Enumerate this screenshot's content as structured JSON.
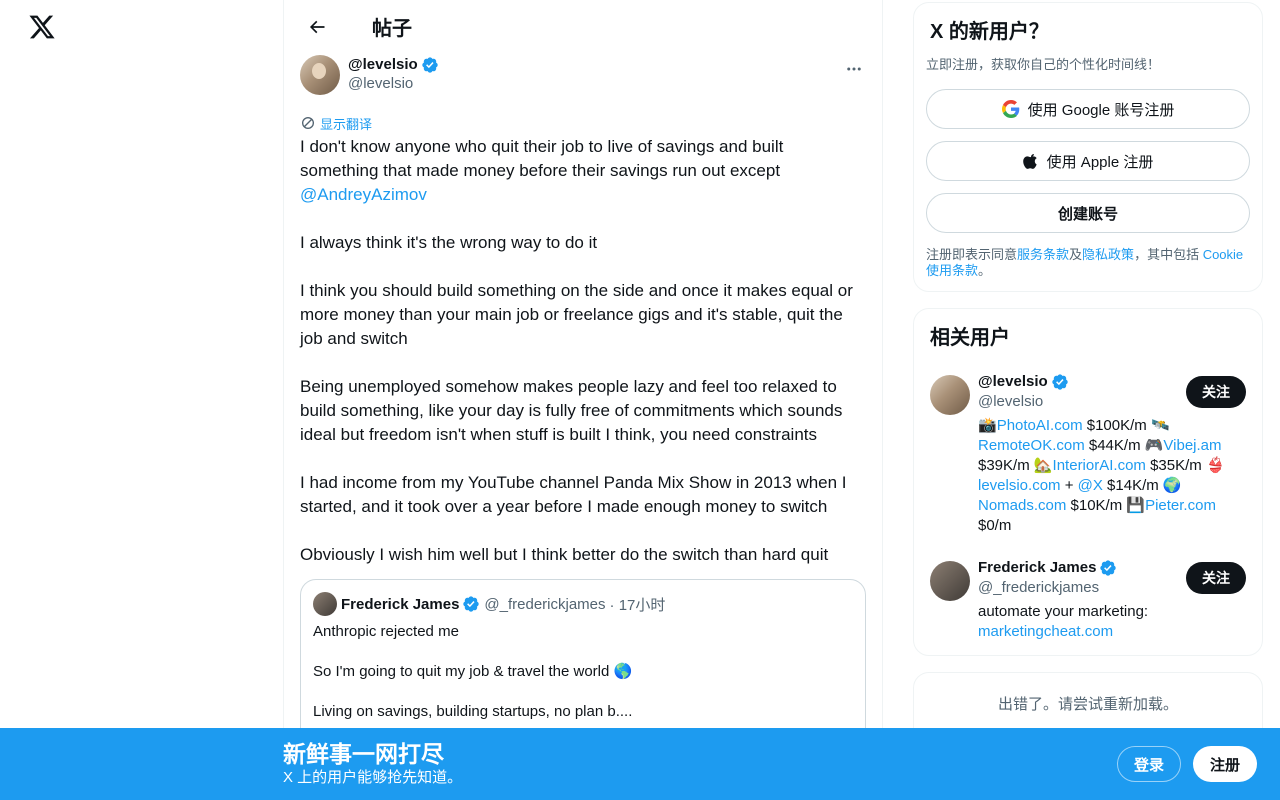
{
  "header": {
    "title": "帖子"
  },
  "post": {
    "author_name": "@levelsio",
    "author_handle": "@levelsio",
    "translate_label": "显示翻译",
    "text_before_mention": "I don't know anyone who quit their job to live of savings and built something that made money before their savings run out except ",
    "mention": "@AndreyAzimov",
    "text_after_mention": "\n\nI always think it's the wrong way to do it\n\nI think you should build something on the side and once it makes equal or more money than your main job or freelance gigs and it's stable, quit the job and switch\n\nBeing unemployed somehow makes people lazy and feel too relaxed to build something, like your day is fully free of commitments which sounds ideal but freedom isn't when stuff is built I think, you need constraints\n\nI had income from my YouTube channel Panda Mix Show in 2013 when I started, and it took over a year before I made enough money to switch\n\nObviously I wish him well but I think better do the switch than hard quit",
    "quote": {
      "name": "Frederick James",
      "handle": "@_frederickjames",
      "time": "· 17小时",
      "text": "Anthropic rejected me\n\nSo I'm going to quit my job & travel the world 🌎\n\nLiving on savings, building startups, no plan b...."
    }
  },
  "signup": {
    "title": "X 的新用户？",
    "subtitle": "立即注册，获取你自己的个性化时间线！",
    "google_label": "使用 Google 账号注册",
    "apple_label": "使用 Apple 注册",
    "create_label": "创建账号",
    "terms_prefix": "注册即表示同意",
    "terms_link": "服务条款",
    "terms_and": "及",
    "privacy_link": "隐私政策",
    "terms_mid": "，其中包括 ",
    "cookie_link": "Cookie 使用条款",
    "terms_end": "。"
  },
  "related": {
    "title": "相关用户",
    "users": [
      {
        "name": "@levelsio",
        "handle": "@levelsio",
        "follow_label": "关注",
        "bio": [
          {
            "t": "📸",
            "link": false
          },
          {
            "t": "PhotoAI.com",
            "link": true
          },
          {
            "t": " $100K/m 🛰️ ",
            "link": false
          },
          {
            "t": "RemoteOK.com",
            "link": true
          },
          {
            "t": " $44K/m 🎮",
            "link": false
          },
          {
            "t": "Vibej.am",
            "link": true
          },
          {
            "t": " $39K/m 🏡",
            "link": false
          },
          {
            "t": "InteriorAI.com",
            "link": true
          },
          {
            "t": " $35K/m 👙 ",
            "link": false
          },
          {
            "t": "levelsio.com",
            "link": true
          },
          {
            "t": " + ",
            "link": false
          },
          {
            "t": "@X",
            "link": true
          },
          {
            "t": " $14K/m 🌍 ",
            "link": false
          },
          {
            "t": "Nomads.com",
            "link": true
          },
          {
            "t": " $10K/m 💾",
            "link": false
          },
          {
            "t": "Pieter.com",
            "link": true
          },
          {
            "t": " $0/m",
            "link": false
          }
        ]
      },
      {
        "name": "Frederick James",
        "handle": "@_frederickjames",
        "follow_label": "关注",
        "bio": [
          {
            "t": "automate your marketing: ",
            "link": false
          },
          {
            "t": "marketingcheat.com",
            "link": true
          }
        ]
      }
    ]
  },
  "error": {
    "text": "出错了。请尝试重新加载。"
  },
  "bottom_bar": {
    "title": "新鲜事一网打尽",
    "subtitle": "X 上的用户能够抢先知道。",
    "login_label": "登录",
    "signup_label": "注册"
  },
  "colors": {
    "accent": "#1d9bf0",
    "text": "#0f1419",
    "muted": "#536471",
    "border": "#eff3f4"
  }
}
